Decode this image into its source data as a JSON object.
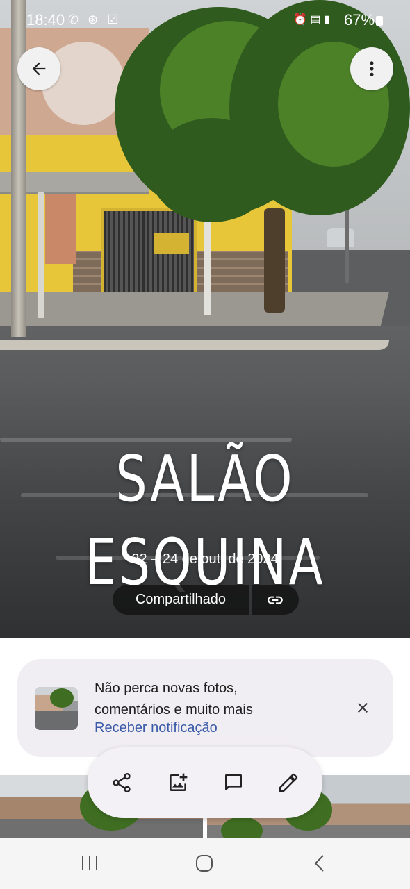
{
  "status_bar": {
    "time": "18:40",
    "left_icons": [
      "whatsapp-icon",
      "news-icon",
      "check-icon"
    ],
    "right_icons": [
      "alarm-icon",
      "5g-icon",
      "signal-icon"
    ],
    "battery": "67%"
  },
  "album": {
    "title": "SALÃO ESQUINA",
    "date_range": "22 – 24 de out. de 2024",
    "shared_label": "Compartilhado"
  },
  "notification": {
    "text": "Não perca novas fotos, comentários e muito mais",
    "action_label": "Receber notificação"
  },
  "actions": [
    "share-icon",
    "add-photo-icon",
    "comment-icon",
    "edit-icon"
  ],
  "nav": [
    "recents-icon",
    "home-icon",
    "back-icon"
  ],
  "colors": {
    "card_background": "#f0edf3",
    "link_blue": "#3a5aa8",
    "chip_dark": "#141414"
  }
}
